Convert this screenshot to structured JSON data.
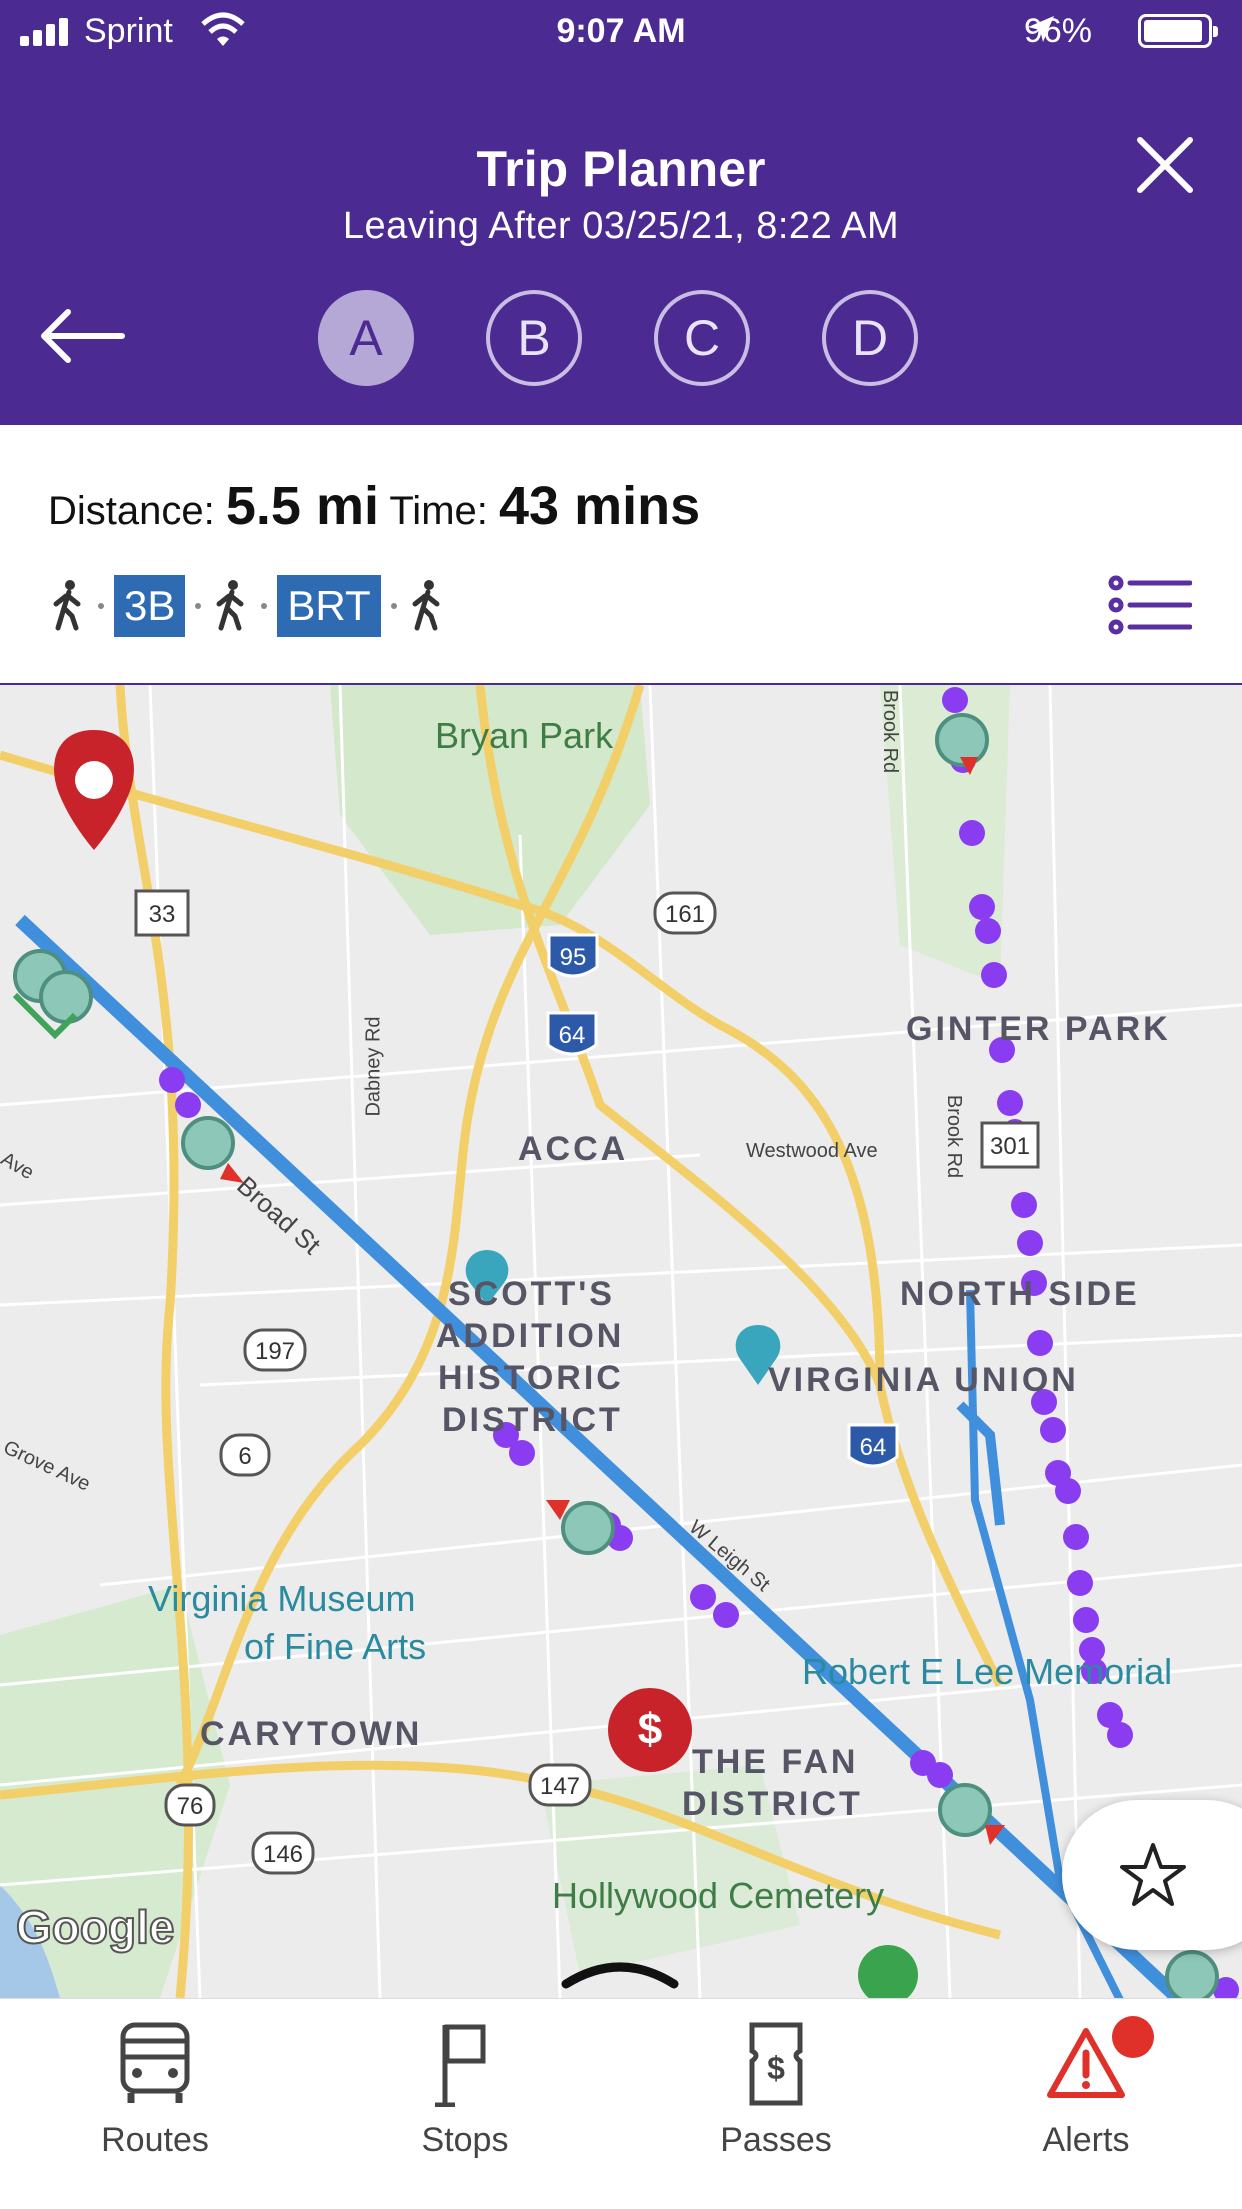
{
  "status_bar": {
    "carrier": "Sprint",
    "time": "9:07 AM",
    "battery": "96%"
  },
  "header": {
    "title": "Trip Planner",
    "subtitle": "Leaving After 03/25/21, 8:22 AM",
    "options": [
      "A",
      "B",
      "C",
      "D"
    ],
    "selected_option": "A"
  },
  "summary": {
    "distance_label": "Distance:",
    "distance_value": "5.5 mi",
    "time_label": "Time:",
    "time_value": "43 mins",
    "legs": [
      "walk",
      "3B",
      "walk",
      "BRT",
      "walk"
    ]
  },
  "map": {
    "labels": {
      "bryan_park": "Bryan Park",
      "ginter_park": "GINTER PARK",
      "acca": "ACCA",
      "westwood": "Westwood Ave",
      "north_side": "NORTH SIDE",
      "scotts1": "SCOTT'S",
      "scotts2": "ADDITION",
      "scotts3": "HISTORIC",
      "scotts4": "DISTRICT",
      "virginia_union": "VIRGINIA UNION",
      "vmfa1": "Virginia Museum",
      "vmfa2": "of Fine Arts",
      "carytown": "CARYTOWN",
      "robert_e_lee": "Robert E Lee Memorial",
      "fan1": "THE FAN",
      "fan2": "DISTRICT",
      "hollywood": "Hollywood Cemetery",
      "broad_st": "Broad St",
      "dabney": "Dabney Rd",
      "brook_rd1": "Brook Rd",
      "brook_rd2": "Brook Rd",
      "grove": "Grove Ave",
      "leigh": "W Leigh St",
      "ave": "Ave",
      "google": "Google"
    },
    "shields": {
      "us33": "33",
      "r161": "161",
      "i95": "95",
      "i64a": "64",
      "us301": "301",
      "r197": "197",
      "r6": "6",
      "i64b": "64",
      "r76": "76",
      "r147": "147",
      "r146": "146"
    }
  },
  "tabs": [
    {
      "label": "Routes",
      "icon": "bus-icon"
    },
    {
      "label": "Stops",
      "icon": "bus-stop-sign-icon"
    },
    {
      "label": "Passes",
      "icon": "ticket-icon"
    },
    {
      "label": "Alerts",
      "icon": "alert-icon"
    }
  ],
  "colors": {
    "header": "#4b2b91",
    "route_line": "#3f8fdc",
    "stop_marker": "#8cc7b8",
    "stop_dot": "#8a3cf0",
    "pin": "#c8232b",
    "badge": "#2f6bb3",
    "alert": "#e0302a"
  }
}
